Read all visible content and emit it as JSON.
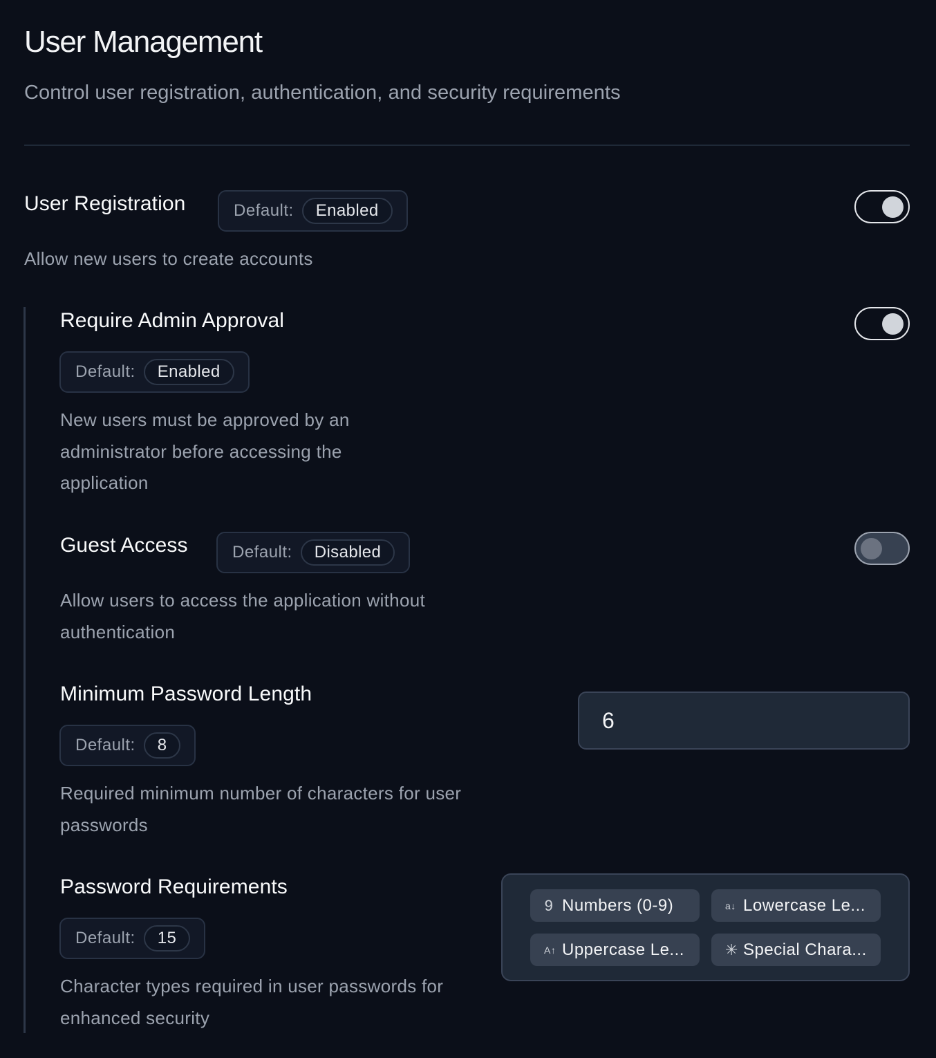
{
  "header": {
    "title": "User Management",
    "subtitle": "Control user registration, authentication, and security requirements"
  },
  "settings": {
    "registration": {
      "title": "User Registration",
      "default_label": "Default:",
      "default_value": "Enabled",
      "description": "Allow new users to create accounts",
      "enabled": true
    },
    "admin_approval": {
      "title": "Require Admin Approval",
      "default_label": "Default:",
      "default_value": "Enabled",
      "description": "New users must be approved by an administrator before accessing the application",
      "enabled": true
    },
    "guest_access": {
      "title": "Guest Access",
      "default_label": "Default:",
      "default_value": "Disabled",
      "description": "Allow users to access the application without authentication",
      "enabled": false
    },
    "min_password_length": {
      "title": "Minimum Password Length",
      "default_label": "Default:",
      "default_value": "8",
      "description": "Required minimum number of characters for user passwords",
      "value": "6"
    },
    "password_requirements": {
      "title": "Password Requirements",
      "default_label": "Default:",
      "default_value": "15",
      "description": "Character types required in user passwords for enhanced security",
      "options": [
        {
          "label": "Numbers (0-9)",
          "icon": "digit-9-icon",
          "glyph": "9"
        },
        {
          "label": "Lowercase Le...",
          "icon": "lowercase-a-icon",
          "glyph": "a↓"
        },
        {
          "label": "Uppercase Le...",
          "icon": "uppercase-a-icon",
          "glyph": "A↑"
        },
        {
          "label": "Special Chara...",
          "icon": "asterisk-icon",
          "glyph": "✳"
        }
      ]
    }
  }
}
